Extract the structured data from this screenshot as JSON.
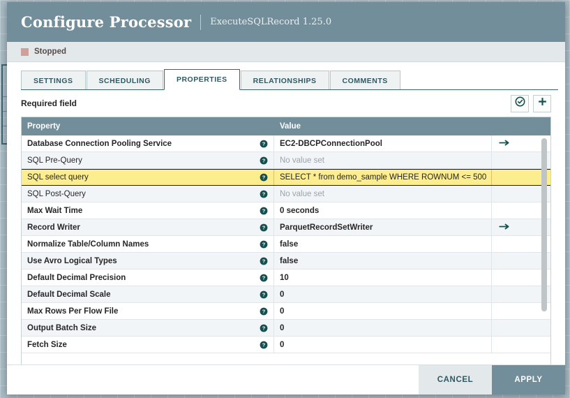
{
  "dialog": {
    "title": "Configure Processor",
    "subtitle": "ExecuteSQLRecord 1.25.0"
  },
  "status": {
    "label": "Stopped",
    "color": "#cf9f9b"
  },
  "tabs": [
    {
      "label": "SETTINGS",
      "active": false
    },
    {
      "label": "SCHEDULING",
      "active": false
    },
    {
      "label": "PROPERTIES",
      "active": true
    },
    {
      "label": "RELATIONSHIPS",
      "active": false
    },
    {
      "label": "COMMENTS",
      "active": false
    }
  ],
  "toolbar": {
    "required_field_label": "Required field",
    "verify_icon": "check-circle-icon",
    "add_icon": "plus-icon"
  },
  "table": {
    "headers": {
      "property": "Property",
      "value": "Value"
    },
    "help_icon": "help-circle-icon",
    "goto_icon": "arrow-right-icon",
    "rows": [
      {
        "name": "Database Connection Pooling Service",
        "value": "EC2-DBCPConnectionPool",
        "required": true,
        "unset": false,
        "action": true,
        "selected": false
      },
      {
        "name": "SQL Pre-Query",
        "value": "No value set",
        "required": false,
        "unset": true,
        "action": false,
        "selected": false
      },
      {
        "name": "SQL select query",
        "value": "SELECT  * from demo_sample WHERE ROWNUM <= 500",
        "required": false,
        "unset": false,
        "action": false,
        "selected": true
      },
      {
        "name": "SQL Post-Query",
        "value": "No value set",
        "required": false,
        "unset": true,
        "action": false,
        "selected": false
      },
      {
        "name": "Max Wait Time",
        "value": "0 seconds",
        "required": true,
        "unset": false,
        "action": false,
        "selected": false
      },
      {
        "name": "Record Writer",
        "value": "ParquetRecordSetWriter",
        "required": true,
        "unset": false,
        "action": true,
        "selected": false
      },
      {
        "name": "Normalize Table/Column Names",
        "value": "false",
        "required": true,
        "unset": false,
        "action": false,
        "selected": false
      },
      {
        "name": "Use Avro Logical Types",
        "value": "false",
        "required": true,
        "unset": false,
        "action": false,
        "selected": false
      },
      {
        "name": "Default Decimal Precision",
        "value": "10",
        "required": true,
        "unset": false,
        "action": false,
        "selected": false
      },
      {
        "name": "Default Decimal Scale",
        "value": "0",
        "required": true,
        "unset": false,
        "action": false,
        "selected": false
      },
      {
        "name": "Max Rows Per Flow File",
        "value": "0",
        "required": true,
        "unset": false,
        "action": false,
        "selected": false
      },
      {
        "name": "Output Batch Size",
        "value": "0",
        "required": true,
        "unset": false,
        "action": false,
        "selected": false
      },
      {
        "name": "Fetch Size",
        "value": "0",
        "required": true,
        "unset": false,
        "action": false,
        "selected": false
      }
    ]
  },
  "footer": {
    "cancel_label": "CANCEL",
    "apply_label": "APPLY"
  },
  "colors": {
    "header_bg": "#728e9b",
    "accent": "#2e5963",
    "selected_row": "#fced8e",
    "canvas_bg": "#a9bbc5"
  }
}
